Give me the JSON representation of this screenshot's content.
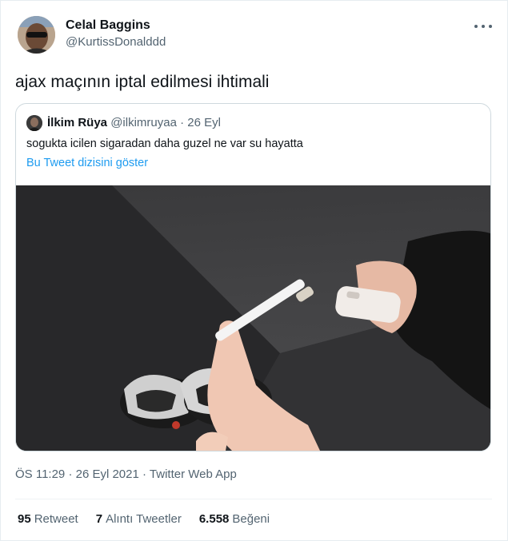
{
  "tweet": {
    "author_name": "Celal Baggins",
    "author_handle": "@KurtissDonalddd",
    "text": "ajax maçının iptal edilmesi ihtimali",
    "time": "ÖS 11:29",
    "date": "26 Eyl 2021",
    "separator": "·",
    "source": "Twitter Web App"
  },
  "quote": {
    "author_name": "İlkim Rüya",
    "author_handle": "@ilkimruyaa",
    "separator": "·",
    "date": "26 Eyl",
    "text": "sogukta icilen sigaradan daha guzel ne var su hayatta",
    "thread_link": "Bu Tweet dizisini göster"
  },
  "stats": [
    {
      "count": "95",
      "label": "Retweet"
    },
    {
      "count": "7",
      "label": "Alıntı Tweetler"
    },
    {
      "count": "6.558",
      "label": "Beğeni"
    }
  ],
  "icons": {
    "more": "more-horizontal-icon"
  }
}
